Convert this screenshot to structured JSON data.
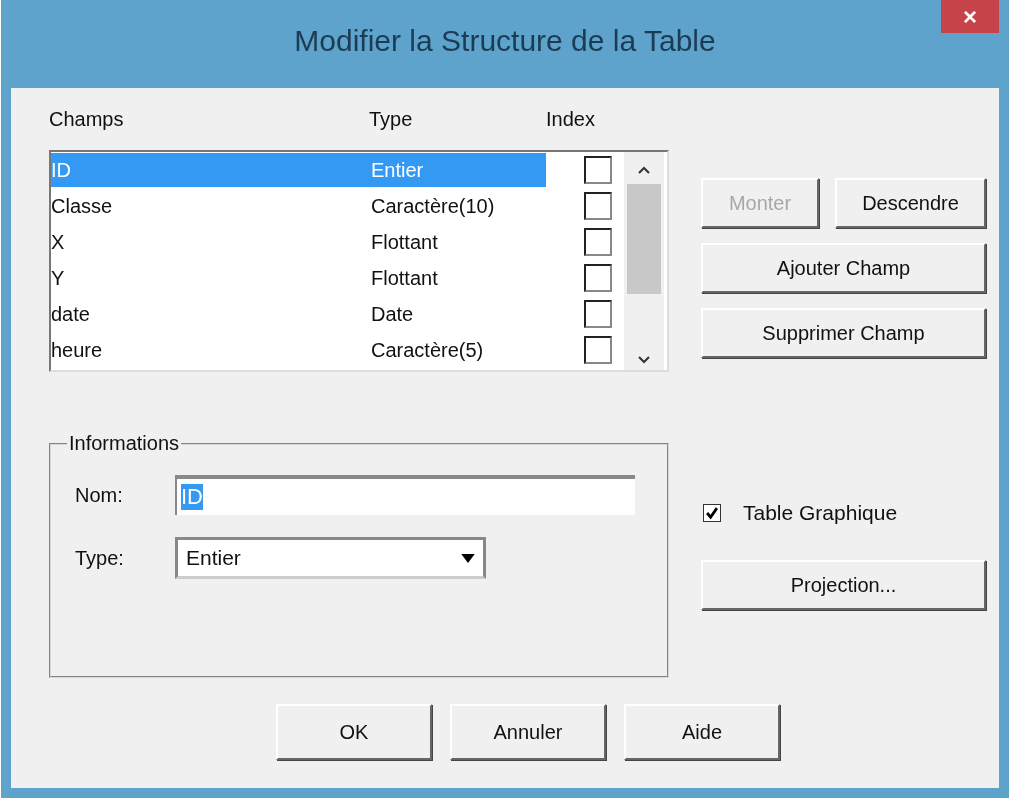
{
  "window": {
    "title": "Modifier la Structure de la Table",
    "close": "×"
  },
  "fields_list": {
    "columns": [
      "Champs",
      "Type",
      "Index"
    ],
    "rows": [
      {
        "name": "ID",
        "type": "Entier",
        "indexed": false,
        "selected": true
      },
      {
        "name": "Classe",
        "type": "Caractère(10)",
        "indexed": false,
        "selected": false
      },
      {
        "name": "X",
        "type": "Flottant",
        "indexed": false,
        "selected": false
      },
      {
        "name": "Y",
        "type": "Flottant",
        "indexed": false,
        "selected": false
      },
      {
        "name": "date",
        "type": "Date",
        "indexed": false,
        "selected": false
      },
      {
        "name": "heure",
        "type": "Caractère(5)",
        "indexed": false,
        "selected": false
      }
    ]
  },
  "side_buttons": [
    {
      "label": "Monter",
      "disabled": true
    },
    {
      "label": "Descendre",
      "disabled": false
    },
    {
      "label": "Ajouter Champ",
      "disabled": false
    },
    {
      "label": "Supprimer Champ",
      "disabled": false
    }
  ],
  "informations": {
    "title": "Informations",
    "name_label": "Nom:",
    "name_value": "ID",
    "type_label": "Type:",
    "type_value": "Entier"
  },
  "graphic_table": {
    "label": "Table Graphique",
    "checked": true
  },
  "projection_button": "Projection...",
  "buttons": [
    "OK",
    "Annuler",
    "Aide"
  ]
}
